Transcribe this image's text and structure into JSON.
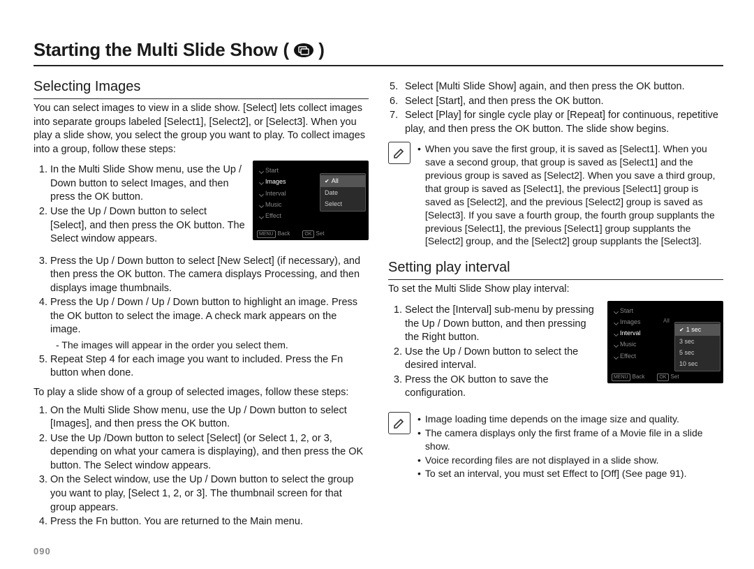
{
  "page_number": "090",
  "title": "Starting the Multi Slide Show",
  "left": {
    "h2": "Selecting Images",
    "intro": "You can select images to view in a slide show. [Select] lets collect images into separate groups labeled [Select1], [Select2], or [Select3]. When you play a slide show, you select the group you want to play. To collect images into a group, follow these steps:",
    "steps_a": [
      "In the Multi Slide Show menu, use the Up / Down button to select Images, and then press the OK button.",
      "Use the Up / Down button to select [Select], and then press the OK button. The Select window appears.",
      "Press the Up / Down button to select [New Select] (if necessary), and then press the OK button. The camera displays Processing, and then displays image thumbnails.",
      "Press the Up / Down / Up / Down button to highlight an image. Press the OK button to select the image. A check mark appears on the image.",
      "Repeat Step 4 for each image you want to included. Press the Fn button when done."
    ],
    "sub4": "- The images will appear in the order you select them.",
    "play_intro": "To play a slide show of a group of selected images, follow these steps:",
    "steps_b": [
      "On the Multi Slide Show menu, use the Up / Down button to select [Images], and then press the OK button.",
      "Use the Up /Down button to select [Select] (or Select 1, 2, or 3, depending on what your camera is displaying), and then press the OK button. The Select window appears.",
      "On the Select window, use the Up / Down button to select the group you want to play, [Select 1, 2, or 3]. The thumbnail screen for that group appears.",
      "Press the Fn button. You are returned to the Main menu."
    ],
    "fig1": {
      "menu": [
        "Start",
        "Images",
        "Interval",
        "Music",
        "Effect"
      ],
      "menu_sel": "Images",
      "sub": [
        "All",
        "Date",
        "Select"
      ],
      "sub_hl": "All",
      "foot_menu": "MENU",
      "foot_back": "Back",
      "foot_ok": "OK",
      "foot_set": "Set"
    }
  },
  "right": {
    "steps_cont": [
      "Select [Multi Slide Show] again, and then press the OK button.",
      "Select [Start], and then press the OK button.",
      "Select [Play] for single cycle play or [Repeat] for continuous, repetitive play, and then press the OK button. The slide show begins."
    ],
    "note1": "When you save the first group, it is saved as [Select1]. When you save a second group, that group is saved as [Select1] and the previous group is saved as [Select2]. When you save a third group, that group is saved as [Select1], the previous [Select1] group is saved as [Select2], and the previous [Select2] group is saved as [Select3]. If you save a fourth group, the fourth group supplants the previous [Select1], the previous [Select1] group supplants the [Select2] group, and the [Select2] group supplants the [Select3].",
    "h2": "Setting play interval",
    "intro": "To set the Multi Slide Show play interval:",
    "steps": [
      "Select the [Interval] sub-menu by pressing the Up / Down button, and then pressing the Right button.",
      "Use the Up / Down button to select the desired interval.",
      "Press the OK button to save the configuration."
    ],
    "fig2": {
      "menu": [
        "Start",
        "Images",
        "Interval",
        "Music",
        "Effect"
      ],
      "menu_sel": "Interval",
      "menu_right_images": "All",
      "sub": [
        "1 sec",
        "3 sec",
        "5 sec",
        "10 sec"
      ],
      "sub_hl": "1 sec",
      "foot_menu": "MENU",
      "foot_back": "Back",
      "foot_ok": "OK",
      "foot_set": "Set"
    },
    "note2": [
      "Image loading time depends on the image size and quality.",
      "The camera displays only the first frame of a Movie file in a slide show.",
      "Voice recording files are not displayed in a slide show.",
      "To set an interval, you must set Effect to [Off] (See page 91)."
    ]
  }
}
